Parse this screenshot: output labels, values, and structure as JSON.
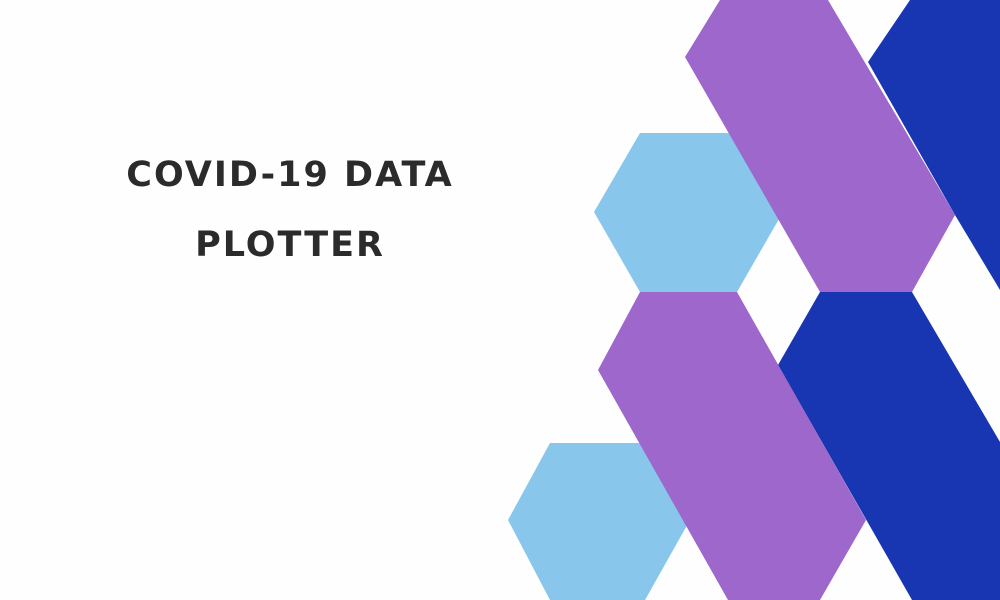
{
  "title": {
    "line1": "COVID-19 DATA",
    "line2": "PLOTTER"
  },
  "colors": {
    "background": "#fefefe",
    "title_text": "#2b2b2b",
    "light_blue": "#88c6ec",
    "purple": "#9d67cb",
    "dark_blue": "#1836b2"
  },
  "shapes": [
    {
      "name": "hexagon-light-blue",
      "color": "light_blue"
    },
    {
      "name": "parallelogram-purple",
      "color": "purple"
    },
    {
      "name": "parallelogram-dark-blue",
      "color": "dark_blue"
    }
  ]
}
